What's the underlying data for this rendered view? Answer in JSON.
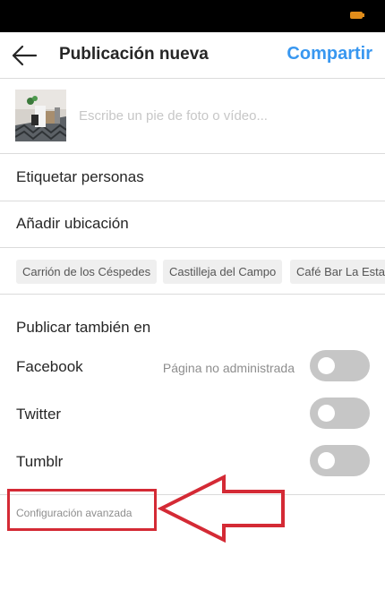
{
  "header": {
    "title": "Publicación nueva",
    "share_label": "Compartir"
  },
  "caption": {
    "placeholder": "Escribe un pie de foto o vídeo..."
  },
  "rows": {
    "tag_people": "Etiquetar personas",
    "add_location": "Añadir ubicación"
  },
  "location_suggestions": [
    "Carrión de los Céspedes",
    "Castilleja del Campo",
    "Café Bar La Esta"
  ],
  "also_post": {
    "title": "Publicar también en",
    "networks": [
      {
        "label": "Facebook",
        "note": "Página no administrada",
        "enabled": false
      },
      {
        "label": "Twitter",
        "note": "",
        "enabled": false
      },
      {
        "label": "Tumblr",
        "note": "",
        "enabled": false
      }
    ]
  },
  "advanced_settings": "Configuración avanzada",
  "colors": {
    "accent": "#3897f0",
    "annotation": "#d42a35",
    "toggle_off": "#c6c6c6",
    "status_bar": "#000000"
  },
  "icons": {
    "back": "arrow-left-icon",
    "battery": "battery-icon"
  }
}
